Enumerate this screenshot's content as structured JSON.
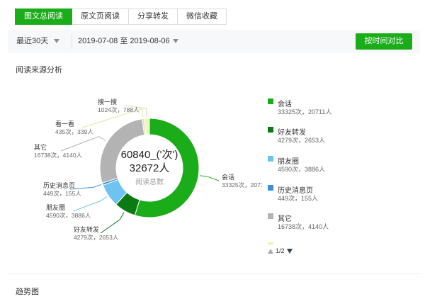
{
  "tabs": [
    {
      "label": "图文总阅读",
      "active": true
    },
    {
      "label": "原文页阅读",
      "active": false
    },
    {
      "label": "分享转发",
      "active": false
    },
    {
      "label": "微信收藏",
      "active": false
    }
  ],
  "filter": {
    "period": "最近30天",
    "date_range": "2019-07-08 至 2019-08-06",
    "compare_button": "按时间对比"
  },
  "section_source": "阅读来源分析",
  "section_trend": "趋势图",
  "center": {
    "line1": "60840_('次')",
    "line2": "32672人",
    "line3": "阅读总数"
  },
  "chart_data": {
    "type": "pie",
    "slices": [
      {
        "name": "会话",
        "times": 33325,
        "people": 20711,
        "label": "33325次，20711人",
        "color": "#1aad19"
      },
      {
        "name": "好友转发",
        "times": 4279,
        "people": 2653,
        "label": "4279次，2653人",
        "color": "#0c7a12"
      },
      {
        "name": "朋友圈",
        "times": 4590,
        "people": 3886,
        "label": "4590次，3886人",
        "color": "#6ec4ee"
      },
      {
        "name": "历史消息页",
        "times": 449,
        "people": 155,
        "label": "449次，155人",
        "color": "#3b8fd9"
      },
      {
        "name": "其它",
        "times": 16738,
        "people": 4140,
        "label": "16738次，4140人",
        "color": "#b3b3b3"
      },
      {
        "name": "看一看",
        "times": 435,
        "people": 339,
        "label": "435次，339人",
        "color": "#d5e9a3"
      },
      {
        "name": "搜一搜",
        "times": 1024,
        "people": 788,
        "label": "1024次，788人",
        "color": "#f0f5c6"
      }
    ],
    "total_times": 60840,
    "total_people": 32672
  },
  "pager": {
    "text": "1/2"
  }
}
